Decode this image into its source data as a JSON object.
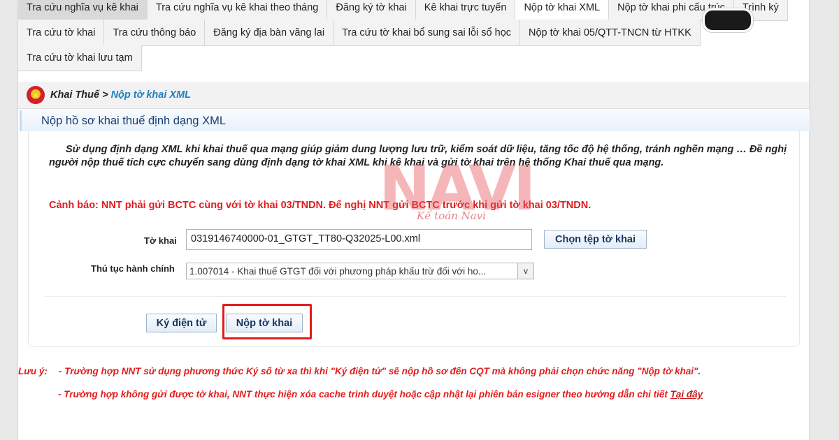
{
  "tabs": {
    "row1": [
      "Tra cứu nghĩa vụ kê khai",
      "Tra cứu nghĩa vụ kê khai theo tháng",
      "Đăng ký tờ khai",
      "Kê khai trực tuyến",
      "Nộp tờ khai XML",
      "Nộp tờ khai phi cấu trúc",
      "Trình ký"
    ],
    "row2": [
      "Tra cứu tờ khai",
      "Tra cứu thông báo",
      "Đăng ký địa bàn vãng lai",
      "Tra cứu tờ khai bổ sung sai lỗi sổ học",
      "Nộp tờ khai 05/QTT-TNCN từ HTKK"
    ],
    "row3": [
      "Tra cứu tờ khai lưu tạm"
    ],
    "active": "Nộp tờ khai XML"
  },
  "breadcrumb": {
    "home": "Khai Thuế",
    "separator": ">",
    "current": "Nộp tờ khai XML"
  },
  "panel": {
    "title": "Nộp hồ sơ khai thuế định dạng XML"
  },
  "intro_text": "Sử dụng định dạng XML khi khai thuế qua mạng giúp giảm dung lượng lưu trữ, kiểm soát dữ liệu, tăng tốc độ hệ thống, tránh nghẽn mạng … Đề nghị người nộp thuế tích cực chuyển sang dùng định dạng tờ khai XML khi kê khai và gửi tờ khai trên hệ thống Khai thuế qua mạng.",
  "warning": "Cảnh báo: NNT phải gửi BCTC cùng với tờ khai 03/TNDN. Để nghị NNT gửi BCTC trước khi gửi tờ khai 03/TNDN.",
  "form": {
    "file_label": "Tờ khai",
    "file_value": "0319146740000-01_GTGT_TT80-Q32025-L00.xml",
    "choose_file_label": "Chọn tệp tờ khai",
    "procedure_label": "Thủ tục hành chính",
    "procedure_value": "1.007014 - Khai thuế GTGT đối với phương pháp khấu trừ đối với ho...",
    "procedure_arrow": "v"
  },
  "actions": {
    "sign_label": "Ký điện tử",
    "submit_label": "Nộp tờ khai"
  },
  "notes": {
    "label": "Lưu ý:",
    "note1": "- Trường hợp NNT sử dụng phương thức Ký số từ xa thì khi \"Ký điện tử\" sẽ nộp hồ sơ đến CQT mà không phải chọn chức năng \"Nộp tờ khai\".",
    "note2": "- Trường hợp không gửi được tờ khai, NNT thực hiện xóa cache trình duyệt hoặc cập nhật lại phiên bản esigner theo hướng dẫn chi tiết",
    "link": "Tại đây"
  },
  "watermark": {
    "logo": "NAVI",
    "subtitle": "Kế toán Navi"
  },
  "colors": {
    "warning_red": "#e21c1c",
    "link_blue": "#1f7fc0",
    "title_blue": "#1a3d6e",
    "highlight_red": "#e21c1c"
  }
}
